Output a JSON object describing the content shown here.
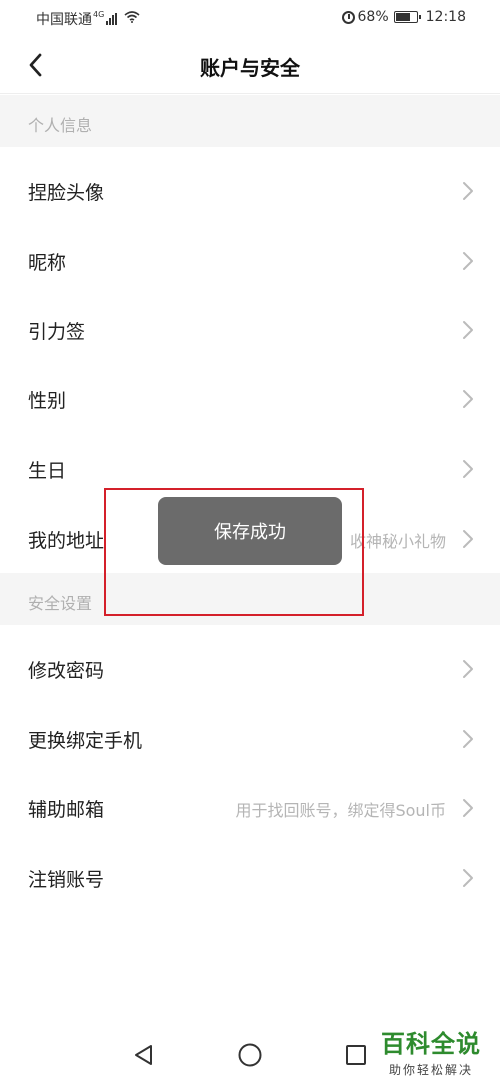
{
  "status_bar": {
    "carrier": "中国联通",
    "network": "4G",
    "battery": "68%",
    "time": "12:18"
  },
  "header": {
    "title": "账户与安全"
  },
  "sections": [
    {
      "title": "个人信息",
      "rows": [
        {
          "label": "捏脸头像",
          "value": ""
        },
        {
          "label": "昵称",
          "value": ""
        },
        {
          "label": "引力签",
          "value": ""
        },
        {
          "label": "性别",
          "value": ""
        },
        {
          "label": "生日",
          "value": ""
        },
        {
          "label": "我的地址",
          "value": "留下地址，收神秘小礼物"
        }
      ]
    },
    {
      "title": "安全设置",
      "rows": [
        {
          "label": "修改密码",
          "value": ""
        },
        {
          "label": "更换绑定手机",
          "value": ""
        },
        {
          "label": "辅助邮箱",
          "value": "用于找回账号，绑定得Soul币"
        },
        {
          "label": "注销账号",
          "value": ""
        }
      ]
    }
  ],
  "toast": {
    "message": "保存成功"
  },
  "watermark": {
    "title": "百科全说",
    "subtitle": "助你轻松解决"
  },
  "icons": {
    "back": "chevron-left-icon",
    "row_arrow": "chevron-right-icon",
    "nav_back": "triangle-back-icon",
    "nav_home": "circle-home-icon",
    "nav_recent": "square-recent-icon"
  },
  "colors": {
    "highlight": "#d4202a",
    "toast_bg": "#6b6b6b",
    "watermark": "#2e8b2e"
  }
}
